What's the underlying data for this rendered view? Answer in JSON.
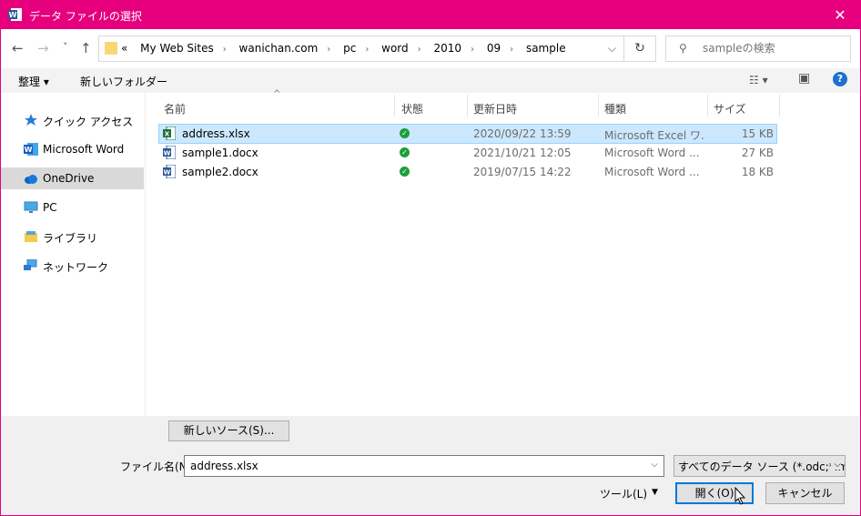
{
  "window": {
    "title": "データ ファイルの選択",
    "close_glyph": "✕",
    "app_icon": "word-icon"
  },
  "nav_buttons": {
    "back": "←",
    "forward": "→",
    "recent": "˅",
    "up": "↑"
  },
  "address": {
    "overflow": "«",
    "crumbs": [
      "My Web Sites",
      "wanichan.com",
      "pc",
      "word",
      "2010",
      "09",
      "sample"
    ],
    "separator": "›",
    "dropdown": "⌵",
    "refresh": "↻"
  },
  "search": {
    "placeholder": "sampleの検索",
    "icon": "search-icon"
  },
  "command_bar": {
    "organize": "整理 ▾",
    "new_folder": "新しいフォルダー",
    "view_menu": "☷ ▾",
    "preview_pane": "▣",
    "help": "?"
  },
  "nav_pane": {
    "items": [
      {
        "label": "クイック アクセス",
        "icon": "star-icon",
        "selected": false
      },
      {
        "label": "Microsoft Word",
        "icon": "word-icon",
        "selected": false
      },
      {
        "label": "OneDrive",
        "icon": "cloud-icon",
        "selected": true
      },
      {
        "label": "PC",
        "icon": "monitor-icon",
        "selected": false
      },
      {
        "label": "ライブラリ",
        "icon": "library-icon",
        "selected": false
      },
      {
        "label": "ネットワーク",
        "icon": "network-icon",
        "selected": false
      }
    ]
  },
  "file_list": {
    "sort_indicator": "^",
    "columns": [
      "名前",
      "状態",
      "更新日時",
      "種類",
      "サイズ"
    ],
    "rows": [
      {
        "name": "address.xlsx",
        "status": "✓",
        "date": "2020/09/22 13:59",
        "type": "Microsoft Excel ワ...",
        "size": "15 KB",
        "icon": "excel-file-icon",
        "selected": true
      },
      {
        "name": "sample1.docx",
        "status": "✓",
        "date": "2021/10/21 12:05",
        "type": "Microsoft Word ...",
        "size": "27 KB",
        "icon": "word-file-icon",
        "selected": false
      },
      {
        "name": "sample2.docx",
        "status": "✓",
        "date": "2019/07/15 14:22",
        "type": "Microsoft Word ...",
        "size": "18 KB",
        "icon": "word-file-icon",
        "selected": false
      }
    ]
  },
  "bottom": {
    "new_source": "新しいソース(S)...",
    "filename_label": "ファイル名(N):",
    "filename_value": "address.xlsx",
    "filetype_value": "すべてのデータ ソース (*.odc;*.mdb",
    "tools": "ツール(L)",
    "tools_arrow": "▼",
    "open": "開く(O)",
    "cancel": "キャンセル",
    "dropdown": "⌵"
  },
  "colors": {
    "title_bar": "#e6007e",
    "selection": "#cce8ff",
    "status_ok": "#1e9e3e"
  }
}
